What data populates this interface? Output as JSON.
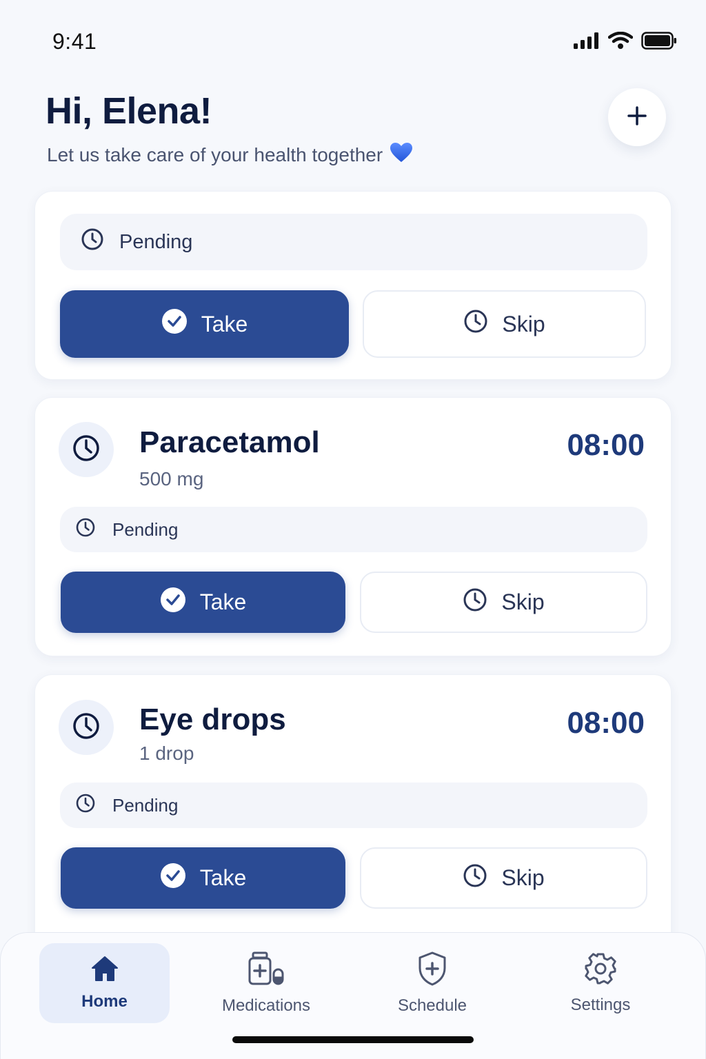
{
  "status_bar": {
    "time": "9:41"
  },
  "header": {
    "greeting": "Hi, Elena!",
    "subtitle": "Let us take care of your health together",
    "add_label": "+"
  },
  "cards": [
    {
      "name": "",
      "dose": "",
      "time": "",
      "status": "Pending",
      "take_label": "Take",
      "skip_label": "Skip"
    },
    {
      "name": "Paracetamol",
      "dose": "500 mg",
      "time": "08:00",
      "status": "Pending",
      "take_label": "Take",
      "skip_label": "Skip"
    },
    {
      "name": "Eye drops",
      "dose": "1 drop",
      "time": "08:00",
      "status": "Pending",
      "take_label": "Take",
      "skip_label": "Skip"
    }
  ],
  "nav": {
    "items": [
      {
        "label": "Home",
        "icon": "home-icon",
        "active": true
      },
      {
        "label": "Medications",
        "icon": "medication-icon",
        "active": false
      },
      {
        "label": "Schedule",
        "icon": "shield-plus-icon",
        "active": false
      },
      {
        "label": "Settings",
        "icon": "gear-icon",
        "active": false
      }
    ]
  },
  "colors": {
    "primary": "#2b4b94",
    "time_text": "#1e3a7a",
    "heading": "#0f1c3f",
    "background": "#f6f8fc",
    "heart": "#3b6fe0"
  }
}
